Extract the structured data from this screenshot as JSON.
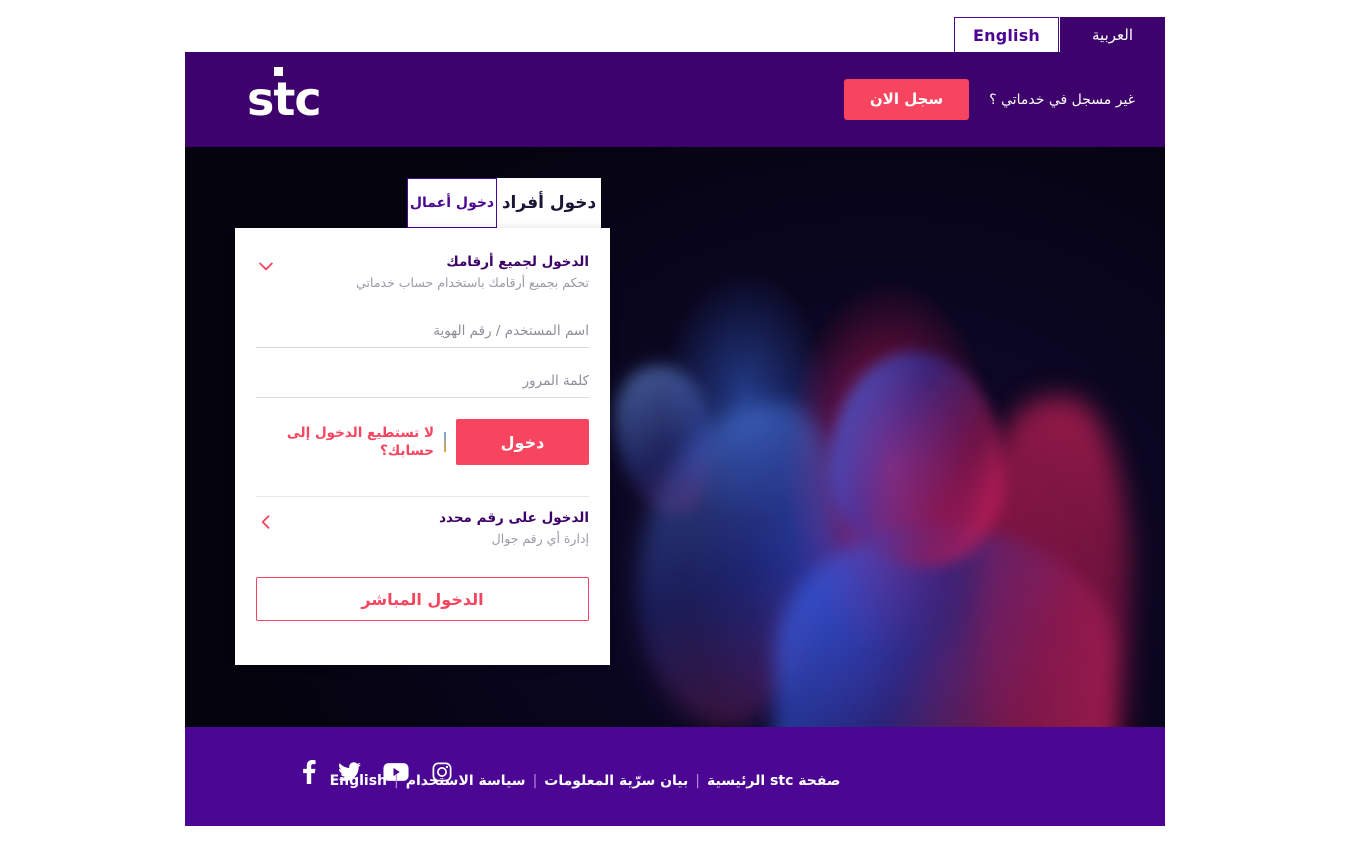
{
  "language_tabs": [
    {
      "label": "العربية",
      "active": true
    },
    {
      "label": "English",
      "active": false
    }
  ],
  "header": {
    "logo_text_1": "s",
    "logo_text_2": "t",
    "logo_text_3": "c",
    "register_note": "غير مسجل في خدماتي ؟",
    "register_button": "سجل الان",
    "background_color": "#3D026B",
    "accent_color": "#F7445F"
  },
  "login_tabs": [
    {
      "label": "دخول أفراد",
      "active": true
    },
    {
      "label": "دخول أعمال",
      "active": false
    }
  ],
  "card": {
    "all_numbers": {
      "title": "الدخول لجميع أرقامك",
      "subtitle": "تحكم بجميع أرقامك باستخدام حساب خدماتي",
      "icon": "chevron-down-icon"
    },
    "username_field": {
      "placeholder": "اسم المستخدم / رقم الهوية",
      "value": ""
    },
    "password_field": {
      "placeholder": "كلمة المرور",
      "value": ""
    },
    "login_button": "دخول",
    "trouble_link": "لا تستطيع الدخول إلى حسابك؟",
    "specific_number": {
      "title": "الدخول على رقم محدد",
      "subtitle": "إدارة أي رقم جوال",
      "icon": "chevron-left-icon"
    },
    "direct_login_button": "الدخول المباشر"
  },
  "footer": {
    "background_color": "#4B0794",
    "social": [
      {
        "name": "instagram-icon"
      },
      {
        "name": "youtube-icon"
      },
      {
        "name": "twitter-icon"
      },
      {
        "name": "facebook-icon"
      }
    ],
    "links": [
      "صفحة stc الرئيسية",
      "بيان سرّية المعلومات",
      "سياسة الاستخدام",
      "English"
    ],
    "separator": "|"
  }
}
